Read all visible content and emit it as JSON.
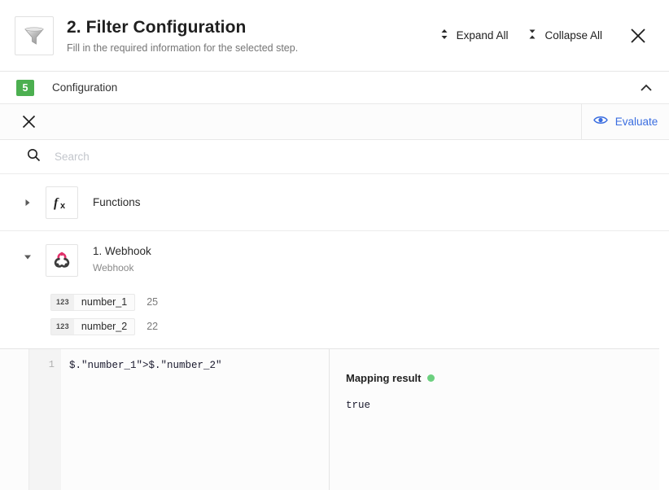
{
  "header": {
    "icon": "funnel-icon",
    "title": "2. Filter Configuration",
    "subtitle": "Fill in the required information for the selected step.",
    "expand_all_label": "Expand All",
    "collapse_all_label": "Collapse All",
    "expand_icon": "expand-vertical-icon",
    "collapse_icon": "collapse-vertical-icon",
    "close_icon": "close-icon"
  },
  "section": {
    "badge": "5",
    "label": "Configuration",
    "chevron_icon": "chevron-up-icon",
    "badge_color": "#4caf50"
  },
  "toolbar": {
    "clear_icon": "close-icon",
    "evaluate_label": "Evaluate",
    "evaluate_icon": "eye-icon",
    "evaluate_color": "#3b6ee0"
  },
  "search": {
    "icon": "search-icon",
    "value": "",
    "placeholder": "Search"
  },
  "tree": {
    "functions": {
      "caret_icon": "caret-right-icon",
      "icon": "fx-icon",
      "label": "Functions"
    },
    "webhook": {
      "caret_icon": "caret-down-icon",
      "icon": "webhook-icon",
      "title": "1. Webhook",
      "subtitle": "Webhook",
      "variables": [
        {
          "type": "123",
          "name": "number_1",
          "value": "25"
        },
        {
          "type": "123",
          "name": "number_2",
          "value": "22"
        }
      ]
    }
  },
  "editor": {
    "line_number": "1",
    "code": "$.\"number_1\">$.\"number_2\""
  },
  "result": {
    "title": "Mapping result",
    "status_color": "#6cd07f",
    "value": "true"
  }
}
